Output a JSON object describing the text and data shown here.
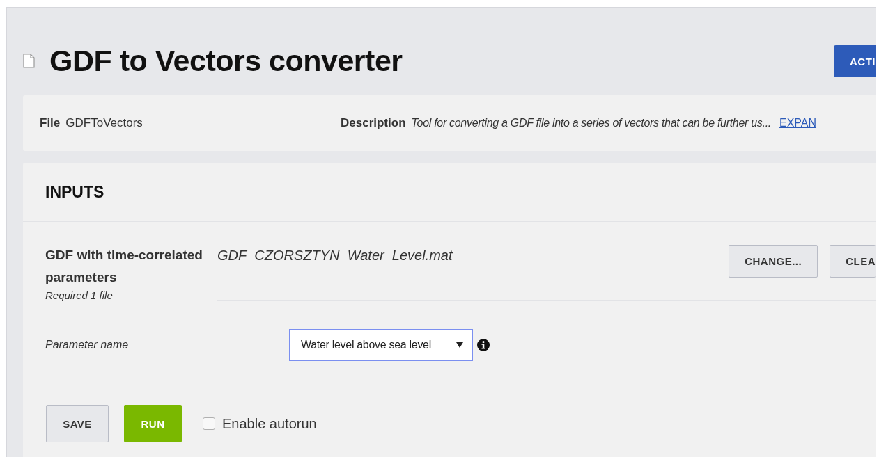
{
  "page": {
    "title": "GDF to Vectors converter",
    "action_button": "ACTI"
  },
  "info": {
    "file_label": "File",
    "file_value": "GDFToVectors",
    "description_label": "Description",
    "description_value": "Tool for converting a GDF file into a series of vectors that can be further us...",
    "expand_link": "EXPAN"
  },
  "inputs": {
    "heading": "INPUTS",
    "file_input": {
      "label": "GDF with time-correlated parameters",
      "hint": "Required 1 file",
      "file_name": "GDF_CZORSZTYN_Water_Level.mat",
      "buttons": [
        "CHANGE...",
        "CLEA"
      ]
    },
    "parameter": {
      "label": "Parameter name",
      "value": "Water level above sea level",
      "focused": true
    }
  },
  "footer": {
    "buttons": [
      {
        "label": "SAVE",
        "kind": "secondary"
      },
      {
        "label": "RUN",
        "kind": "primary"
      }
    ],
    "autorun": {
      "label": "Enable autorun",
      "checked": false
    }
  }
}
